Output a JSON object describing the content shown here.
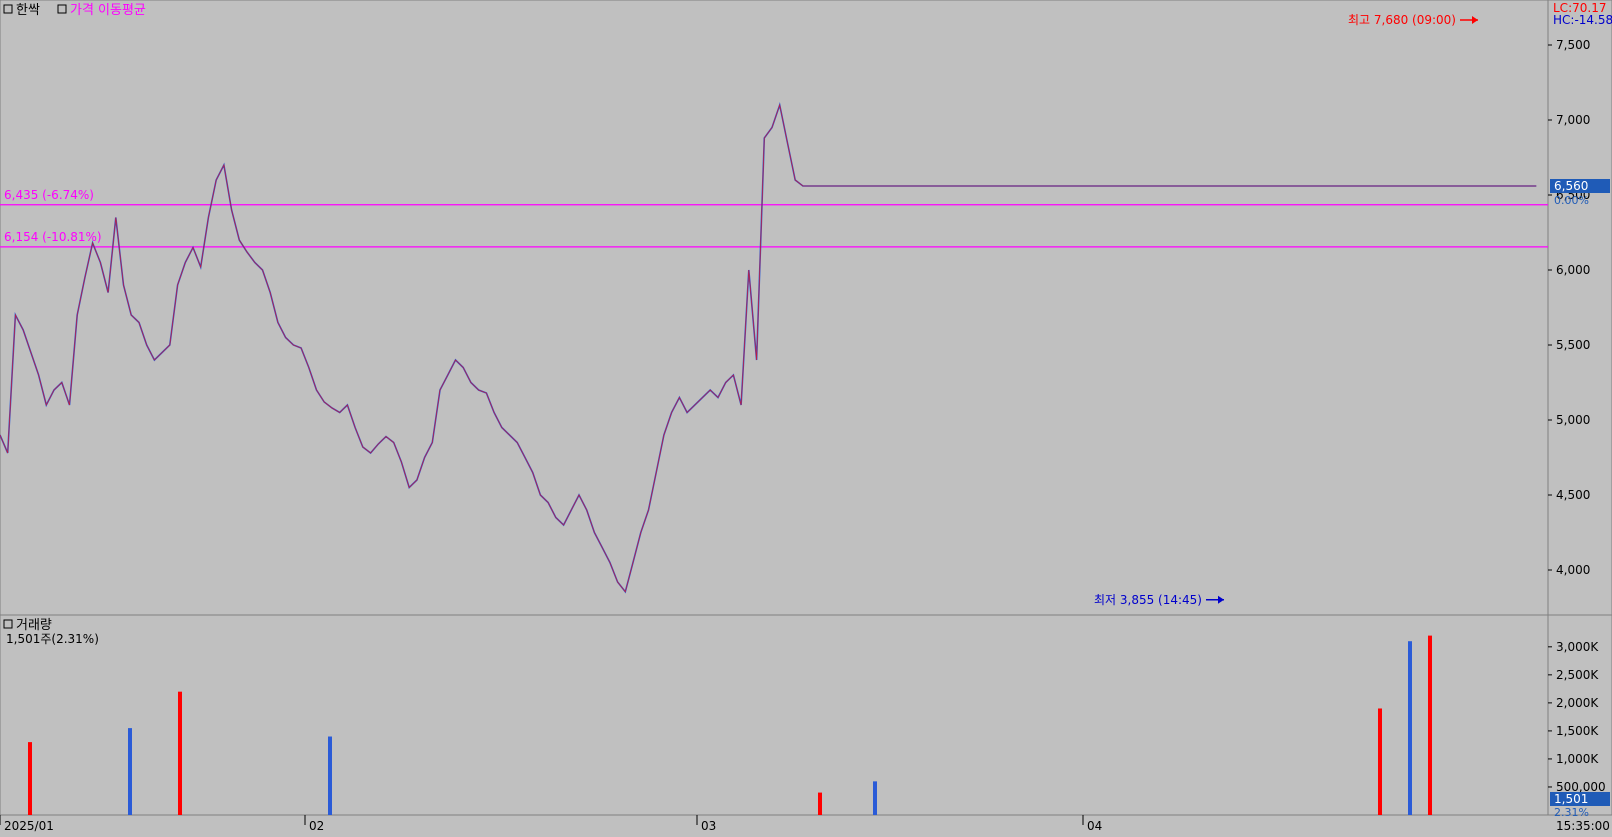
{
  "header": {
    "stock_name": "한싹",
    "indicator_label": "가격 이동평균",
    "lc_label": "LC:70.17",
    "hc_label": "HC:-14.58"
  },
  "volume_panel": {
    "title": "거래량",
    "current": "1,501주(2.31%)"
  },
  "time_label": "15:35:00",
  "chart_data": [
    {
      "type": "line",
      "title": "",
      "x_ticks": [
        "2025/01",
        "02",
        "03",
        "04"
      ],
      "y_ticks": [
        "4,000",
        "4,500",
        "5,000",
        "5,500",
        "6,000",
        "6,500",
        "7,000",
        "7,500"
      ],
      "ylim": [
        3700,
        7800
      ],
      "x": [
        0,
        5,
        10,
        15,
        20,
        25,
        30,
        35,
        40,
        45,
        50,
        55,
        60,
        65,
        70,
        75,
        80,
        85,
        90,
        95,
        100,
        105,
        110,
        115,
        120,
        125,
        130,
        135,
        140,
        145,
        150,
        155,
        160,
        165,
        170,
        175,
        180,
        185,
        190,
        195,
        200,
        205,
        210,
        215,
        220,
        225,
        230,
        235,
        240,
        245,
        250,
        255,
        260,
        265,
        270,
        275,
        280,
        285,
        290,
        295,
        300,
        305,
        310,
        315,
        320,
        325,
        330,
        335,
        340,
        345,
        350,
        355,
        360,
        365,
        370,
        375,
        380,
        385,
        390,
        395,
        400,
        405,
        410,
        415,
        420,
        425,
        430,
        435,
        440,
        445,
        450,
        455,
        460,
        465,
        470,
        475,
        480,
        485,
        490,
        495,
        500,
        505,
        510,
        515,
        520,
        525,
        530,
        535,
        540,
        545,
        550,
        555,
        560,
        565,
        570,
        575,
        580,
        585,
        590,
        595,
        600,
        605,
        610,
        615,
        620,
        625,
        630,
        635,
        640,
        645,
        650,
        655,
        660,
        665,
        670,
        675,
        680,
        685,
        690,
        695,
        700,
        705,
        710,
        715,
        720,
        725,
        730,
        735,
        740,
        745,
        750,
        755,
        760,
        765,
        770,
        775,
        780,
        785,
        790,
        795,
        800,
        805,
        810,
        815,
        820,
        825,
        830,
        835,
        840,
        845,
        850,
        855,
        860,
        865,
        870,
        875,
        880,
        885,
        890,
        895,
        900,
        905,
        910,
        915,
        920,
        925,
        930,
        935,
        940,
        945,
        950,
        955,
        960,
        965,
        970,
        975,
        980,
        985,
        990,
        995,
        1000
      ],
      "y": [
        4900,
        4780,
        5700,
        5600,
        5450,
        5300,
        5100,
        5200,
        5250,
        5100,
        5700,
        5950,
        6180,
        6050,
        5850,
        6350,
        5900,
        5700,
        5650,
        5500,
        5400,
        5450,
        5500,
        5900,
        6050,
        6150,
        6020,
        6350,
        6600,
        6700,
        6400,
        6200,
        6120,
        6050,
        6000,
        5850,
        5650,
        5550,
        5500,
        5480,
        5350,
        5200,
        5120,
        5080,
        5050,
        5100,
        4950,
        4820,
        4780,
        4840,
        4890,
        4850,
        4720,
        4550,
        4600,
        4750,
        4850,
        5200,
        5300,
        5400,
        5350,
        5250,
        5200,
        5180,
        5050,
        4950,
        4900,
        4850,
        4750,
        4650,
        4500,
        4450,
        4350,
        4300,
        4400,
        4500,
        4400,
        4250,
        4150,
        4050,
        3920,
        3855,
        4050,
        4250,
        4400,
        4650,
        4900,
        5050,
        5150,
        5050,
        5100,
        5150,
        5200,
        5150,
        5250,
        5300,
        5100,
        6000,
        5400,
        6880,
        6950,
        7100,
        6850,
        6600,
        6560,
        6560,
        6560,
        6560,
        6560,
        6560,
        6560,
        6560,
        6560,
        6560,
        6560,
        6560,
        6560,
        6560,
        6560,
        6560,
        6560,
        6560,
        6560,
        6560,
        6560,
        6560,
        6560,
        6560,
        6560,
        6560,
        6560,
        6560,
        6560,
        6560,
        6560,
        6560,
        6560,
        6560,
        6560,
        6560,
        6560,
        6560,
        6560,
        6560,
        6560,
        6560,
        6560,
        6560,
        6560,
        6560,
        6560,
        6560,
        6560,
        6560,
        6560,
        6560,
        6560,
        6560,
        6560,
        6560,
        6560,
        6560,
        6560,
        6560,
        6560,
        6560,
        6560,
        6560,
        6560,
        6560,
        6560,
        6560,
        6560,
        6560,
        6560,
        6560,
        6560,
        6560,
        6560,
        6560,
        6560,
        6560,
        6560,
        6560,
        6560,
        6560,
        6560,
        6560,
        6560,
        6560,
        6560,
        6560,
        6560,
        6560,
        6560,
        6560,
        6560,
        6560,
        6560,
        6560
      ],
      "hlines": [
        {
          "value": 6435,
          "label": "6,435 (-6.74%)",
          "color": "#ff00ff"
        },
        {
          "value": 6154,
          "label": "6,154 (-10.81%)",
          "color": "#ff00ff"
        }
      ],
      "annotations": [
        {
          "label": "최고 7,680 (09:00)",
          "value": 7680,
          "color": "#ff0000"
        },
        {
          "label": "최저 3,855 (14:45)",
          "value": 3855,
          "color": "#0000cc"
        }
      ],
      "current_price": {
        "label": "6,560",
        "sublabel": "0.00%",
        "value": 6560
      },
      "colors": {
        "up": "#ff0000",
        "down": "#2a5bd7",
        "line": "#ff00ff"
      }
    },
    {
      "type": "bar",
      "title": "",
      "y_ticks": [
        "500,000",
        "1,000K",
        "1,500K",
        "2,000K",
        "2,500K",
        "3,000K"
      ],
      "ylim": [
        0,
        3300000
      ],
      "current_volume": {
        "label": "1,501",
        "sublabel": "2.31%"
      },
      "spikes": [
        {
          "x": 30,
          "value": 1300000
        },
        {
          "x": 130,
          "value": 1550000
        },
        {
          "x": 180,
          "value": 2200000
        },
        {
          "x": 330,
          "value": 1400000
        },
        {
          "x": 820,
          "value": 400000
        },
        {
          "x": 875,
          "value": 600000
        },
        {
          "x": 1380,
          "value": 1900000
        },
        {
          "x": 1410,
          "value": 3100000
        },
        {
          "x": 1430,
          "value": 3200000
        }
      ],
      "colors": {
        "up": "#ff0000",
        "down": "#2a5bd7"
      }
    }
  ]
}
